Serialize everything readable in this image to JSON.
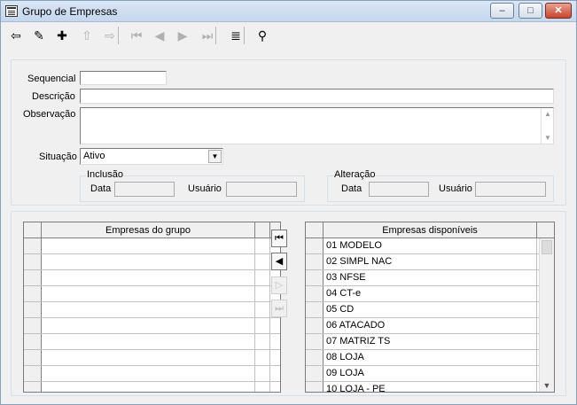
{
  "window": {
    "title": "Grupo de Empresas"
  },
  "window_controls": {
    "minimize": "–",
    "maximize": "□",
    "close": "✕"
  },
  "toolbar": {
    "buttons": [
      {
        "name": "exit-icon",
        "glyph": "⇦",
        "enabled": true
      },
      {
        "name": "pencil-icon",
        "glyph": "✎",
        "enabled": true
      },
      {
        "name": "folder-add-icon",
        "glyph": "✚",
        "enabled": true
      },
      {
        "name": "folder-up-icon",
        "glyph": "⇧",
        "enabled": false
      },
      {
        "name": "folder-remove-icon",
        "glyph": "⇨",
        "enabled": false
      },
      {
        "name": "first-record-icon",
        "glyph": "⏮",
        "enabled": false
      },
      {
        "name": "prev-record-icon",
        "glyph": "◀",
        "enabled": false
      },
      {
        "name": "next-record-icon",
        "glyph": "▶",
        "enabled": false
      },
      {
        "name": "last-record-icon",
        "glyph": "⏭",
        "enabled": false
      },
      {
        "name": "list-icon",
        "glyph": "≣",
        "enabled": true
      },
      {
        "name": "binoculars-icon",
        "glyph": "⚲",
        "enabled": true
      }
    ]
  },
  "form": {
    "sequencial_label": "Sequencial",
    "sequencial_value": "",
    "descricao_label": "Descrição",
    "descricao_value": "",
    "observacao_label": "Observação",
    "observacao_value": "",
    "situacao_label": "Situação",
    "situacao_value": "Ativo",
    "inclusao": {
      "legend": "Inclusão",
      "data_label": "Data",
      "usuario_label": "Usuário",
      "data_value": "",
      "usuario_value": ""
    },
    "alteracao": {
      "legend": "Alteração",
      "data_label": "Data",
      "usuario_label": "Usuário",
      "data_value": "",
      "usuario_value": ""
    }
  },
  "grid_left": {
    "header": "Empresas do grupo",
    "rows": [
      "",
      "",
      "",
      "",
      "",
      "",
      "",
      "",
      "",
      ""
    ]
  },
  "grid_right": {
    "header": "Empresas disponíveis",
    "rows": [
      "01 MODELO",
      "02 SIMPL NAC",
      "03 NFSE",
      "04 CT-e",
      "05 CD",
      "06 ATACADO",
      "07 MATRIZ TS",
      "08 LOJA",
      "09 LOJA",
      "10 LOJA - PE"
    ]
  },
  "transfer_buttons": [
    {
      "glyph": "⏮",
      "enabled": true,
      "name": "add-all-button"
    },
    {
      "glyph": "◀",
      "enabled": true,
      "name": "add-one-button"
    },
    {
      "glyph": "▷",
      "enabled": false,
      "name": "remove-one-button"
    },
    {
      "glyph": "⏭",
      "enabled": false,
      "name": "remove-all-button"
    }
  ]
}
